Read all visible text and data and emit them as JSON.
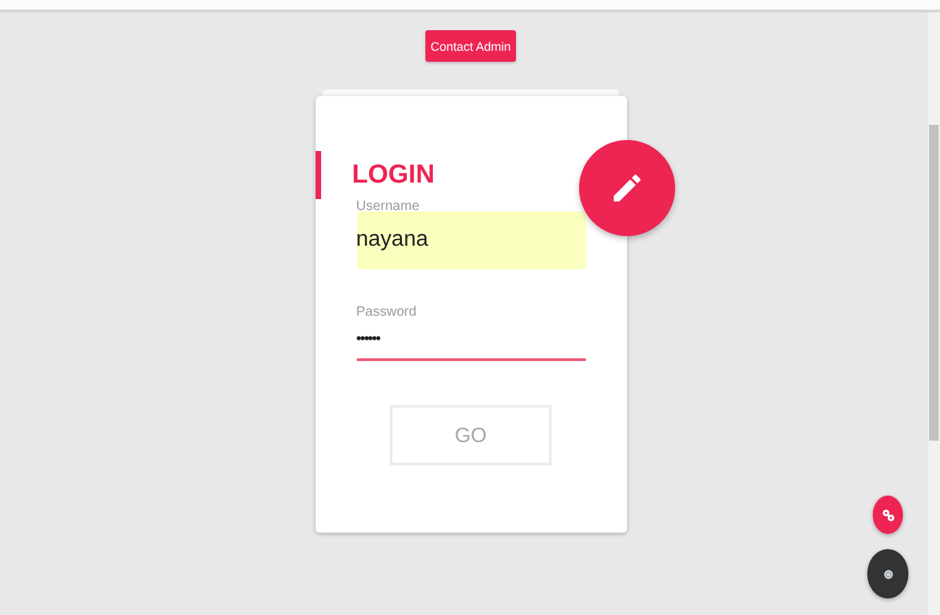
{
  "header_button": {
    "label": "Contact Admin"
  },
  "login_card": {
    "title": "LOGIN",
    "fields": [
      {
        "kind": "text",
        "label": "Username",
        "value": "nayana",
        "autofilled": true,
        "focused": false
      },
      {
        "kind": "password",
        "label": "Password",
        "value": "••••••",
        "autofilled": false,
        "focused": true
      }
    ],
    "submit": {
      "label": "GO",
      "disabled": true
    }
  },
  "floating_buttons": [
    {
      "kind": "link"
    },
    {
      "kind": "settings"
    }
  ]
}
